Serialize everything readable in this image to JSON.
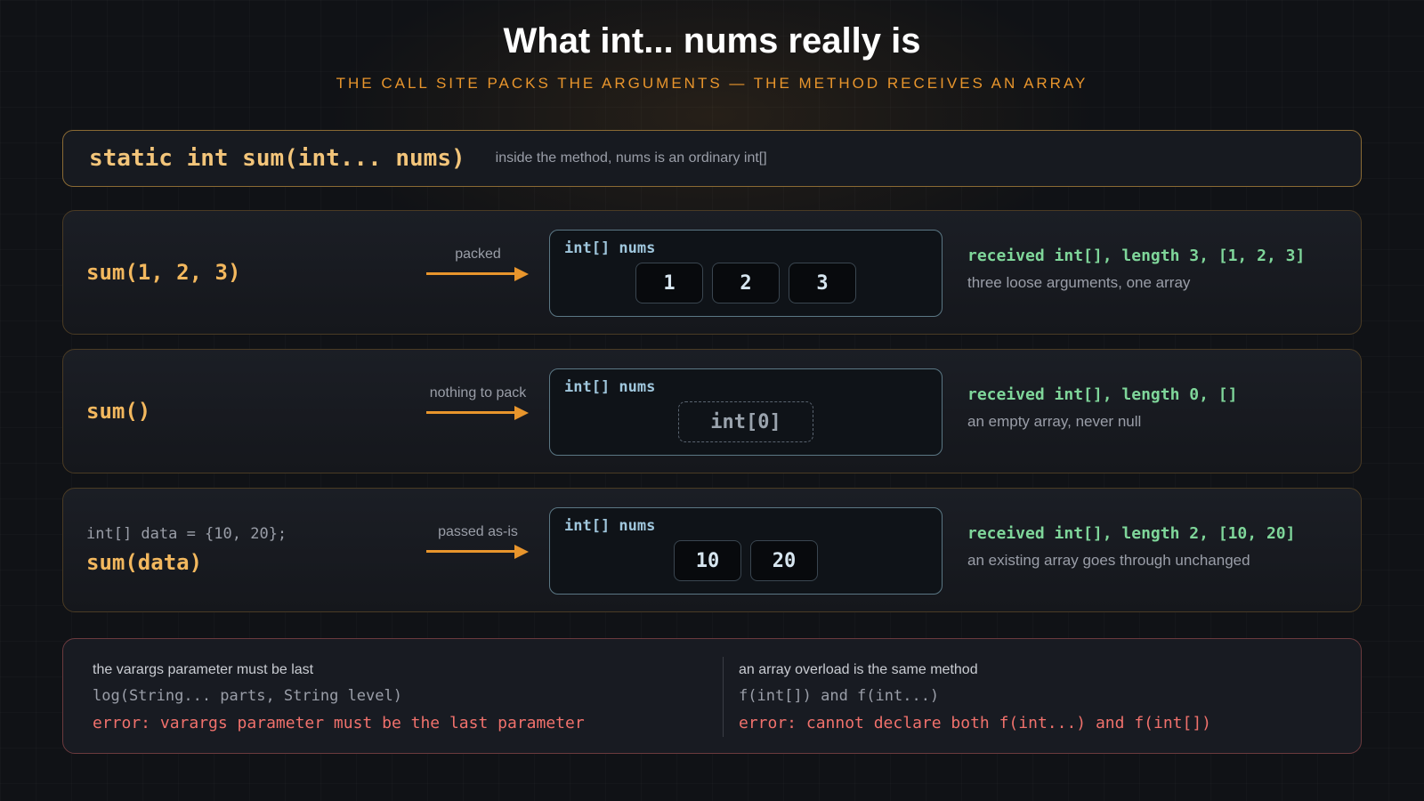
{
  "header": {
    "title": "What int... nums really is",
    "subtitle": "THE CALL SITE PACKS THE ARGUMENTS — THE METHOD RECEIVES AN ARRAY"
  },
  "signature": {
    "code": "static int sum(int... nums)",
    "note": "inside the method, nums is an ordinary int[]"
  },
  "rows": [
    {
      "call": "sum(1, 2, 3)",
      "arrow_label": "packed",
      "array_label": "int[] nums",
      "cells": [
        "1",
        "2",
        "3"
      ],
      "result": "received int[], length 3, [1, 2, 3]",
      "note": "three loose arguments, one array"
    },
    {
      "call": "sum()",
      "arrow_label": "nothing to pack",
      "array_label": "int[] nums",
      "empty_label": "int[0]",
      "result": "received int[], length 0, []",
      "note": "an empty array, never null"
    },
    {
      "pre": "int[] data = {10, 20};",
      "call": "sum(data)",
      "arrow_label": "passed as-is",
      "array_label": "int[] nums",
      "cells": [
        "10",
        "20"
      ],
      "result": "received int[], length 2, [10, 20]",
      "note": "an existing array goes through unchanged"
    }
  ],
  "rules": [
    {
      "title": "the varargs parameter must be last",
      "code": "log(String... parts, String level)",
      "error": "error: varargs parameter must be the last parameter"
    },
    {
      "title": "an array overload is the same method",
      "code": "f(int[]) and f(int...)",
      "error": "error: cannot declare both f(int...) and f(int[])"
    }
  ],
  "colors": {
    "accent": "#e8952c",
    "success": "#7fd69a",
    "error": "#f0716c",
    "array_label": "#9fc6dc"
  }
}
